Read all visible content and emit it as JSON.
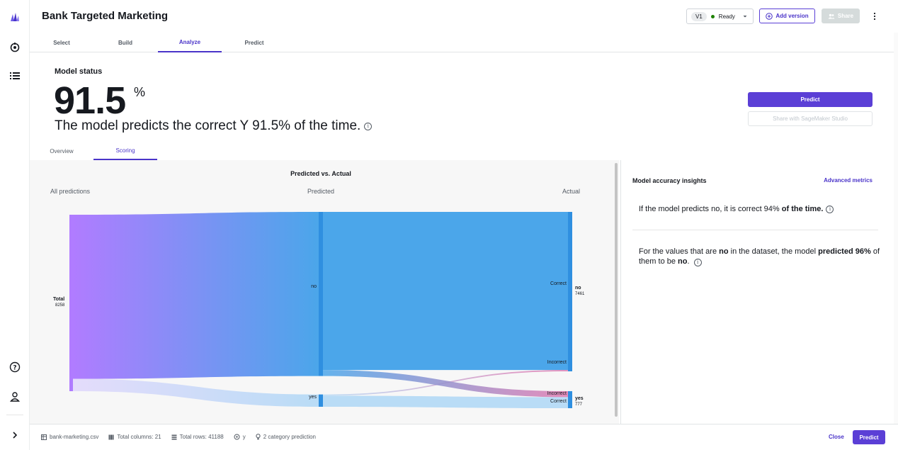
{
  "header": {
    "title": "Bank Targeted Marketing",
    "version_badge": "V1",
    "status": "Ready",
    "add_version": "Add version",
    "share": "Share"
  },
  "main_tabs": [
    {
      "label": "Select"
    },
    {
      "label": "Build"
    },
    {
      "label": "Analyze",
      "active": true
    },
    {
      "label": "Predict"
    }
  ],
  "model_status": {
    "label": "Model status",
    "value": "91.5",
    "unit": "%",
    "description": "The model predicts the correct Y 91.5% of the time."
  },
  "actions": {
    "predict": "Predict",
    "share_studio": "Share with SageMaker Studio"
  },
  "sub_tabs": [
    {
      "label": "Overview"
    },
    {
      "label": "Scoring",
      "active": true
    }
  ],
  "chart_data": {
    "type": "sankey",
    "title": "Predicted vs. Actual",
    "column_labels": [
      "All predictions",
      "Predicted",
      "Actual"
    ],
    "source": {
      "name": "Total",
      "value": 8258
    },
    "predicted": [
      {
        "name": "no"
      },
      {
        "name": "yes"
      }
    ],
    "actual": [
      {
        "name": "no",
        "value": 7461
      },
      {
        "name": "yes",
        "value": 777
      }
    ],
    "flow_labels": [
      "Correct",
      "Incorrect",
      "Incorrect",
      "Correct"
    ],
    "colors": {
      "no": "#4ba6ea",
      "yes": "#b9dcf6",
      "incorrect": "#e07ab0",
      "total": "#b07cff"
    }
  },
  "insights": {
    "title": "Model accuracy insights",
    "advanced": "Advanced metrics",
    "line1_pre": "If the model predicts no, it is correct 94%",
    "line1_bold": " of the time.",
    "line2_a": "For the values that are ",
    "line2_b": "no",
    "line2_c": " in the dataset, the model ",
    "line2_d": "predicted 96%",
    "line2_e": " of them to be ",
    "line2_f": "no",
    "line2_g": "."
  },
  "footer": {
    "file": "bank-marketing.csv",
    "columns": "Total columns: 21",
    "rows": "Total rows: 41188",
    "target": "y",
    "prediction_type": "2 category prediction",
    "close": "Close",
    "predict": "Predict"
  }
}
